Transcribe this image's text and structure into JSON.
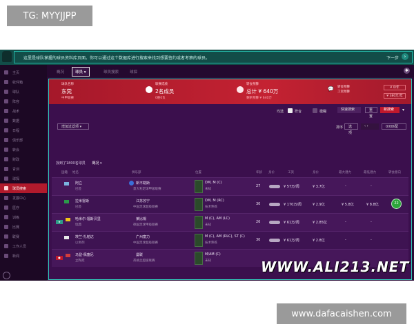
{
  "watermarks": {
    "top": "TG: MYYJJPP",
    "bottom": "www.dafacaishen.com",
    "overlay": "WWW.ALI213.NET"
  },
  "banner": {
    "text": "这里是球队掌握的球员资料库页面。你可以通过这个数据库进行搜索来找到想要签约或者考察的球员。",
    "next": "下一步"
  },
  "nav": {
    "tabs": [
      "概况",
      "球员",
      "球员搜索",
      "球探"
    ],
    "active_index": 1
  },
  "sidebar": {
    "items": [
      "主页",
      "收件箱",
      "球队",
      "阵容",
      "战术",
      "数据",
      "日程",
      "俱乐部",
      "转会",
      "财政",
      "青训",
      "球探",
      "球员搜索",
      "发展中心",
      "医疗",
      "训练",
      "比赛",
      "联赛",
      "工作人员",
      "新闻"
    ],
    "active_index": 12
  },
  "club_header": {
    "col1_small": "球队名称",
    "col1_big": "东莞",
    "col1_sub": "中甲联赛",
    "col2_small": "联赛成绩",
    "col2_big": "2名成员",
    "col2_sub": "0胜0负",
    "col3_small": "转会预算",
    "col3_big": "总计 ¥ 640万",
    "col3_sub": "剩余预算 ¥ 640万",
    "chat_icon": "💬",
    "chat_lines": [
      "转会预算",
      "工资预算"
    ],
    "btn1": "¥ 0/年",
    "btn2": "¥ 380万/年"
  },
  "filters": {
    "label_checkbox1": "符合",
    "label_checkbox2": "模糊",
    "btn_quick": "快速搜索",
    "btn_reset": "重置",
    "btn_new": "新搜索",
    "add_filter": "增加过滤项",
    "sort_label": "排序",
    "sort_value": "选项",
    "view_value": "0/0匹配"
  },
  "table": {
    "summary": "找到了1800名球员",
    "summary_option": "概况",
    "headers": [
      "国籍",
      "姓名",
      "俱乐部",
      "位置",
      "年龄",
      "身价",
      "工资",
      "身价",
      "最大潜力",
      "最低潜力",
      "转会意向"
    ],
    "rows": [
      {
        "name": "阿立",
        "sub": "已签",
        "club": "新不勒斯",
        "club_sub": "意大利足球甲级联赛",
        "pos": "DM, M (C)",
        "pos_sub": "未知",
        "age": "27",
        "wage": "¥ 57万/周",
        "value": "¥ 3.7亿",
        "pot1": "-",
        "pot2": "-",
        "rating": ""
      },
      {
        "name": "拉米雷斯",
        "sub": "已签",
        "club": "江苏苏宁",
        "club_sub": "中国足球超级联赛",
        "pos": "DM, M (RC)",
        "pos_sub": "技术熟练",
        "age": "30",
        "wage": "¥ 170万/周",
        "value": "¥ 2.9亿",
        "pot1": "¥ 5.8亿",
        "pot2": "¥ 8.8亿",
        "rating": "22"
      },
      {
        "name": "哈米尔-福斯贝里",
        "sub": "瑞典",
        "club": "莱比锡",
        "club_sub": "德国足球甲级联赛",
        "pos": "M (C), AM (LC)",
        "pos_sub": "未知",
        "age": "26",
        "wage": "¥ 61万/周",
        "value": "¥ 2.85亿",
        "pot1": "-",
        "pot2": "-",
        "rating": ""
      },
      {
        "name": "埃兰-扎帕达",
        "sub": "以色列",
        "club": "广州富力",
        "club_sub": "中国足球超级联赛",
        "pos": "M (C), AM (RLC), ST (C)",
        "pos_sub": "技术熟练",
        "age": "30",
        "wage": "¥ 61万/周",
        "value": "¥ 2.8亿",
        "pot1": "-",
        "pot2": "-",
        "rating": ""
      },
      {
        "name": "马登-佩塞尼",
        "sub": "立陶宛",
        "club": "曼联",
        "club_sub": "英格兰超级联赛",
        "pos": "M/AM (C)",
        "pos_sub": "未知",
        "age": "30",
        "wage": "¥ 51万/周",
        "value": "¥ 2.75亿",
        "pot1": "-",
        "pot2": "-",
        "rating": ""
      }
    ]
  },
  "colors": {
    "accent_red": "#c42232",
    "frame_teal": "#2fd0bd",
    "background_purple": "#3b0f4d"
  }
}
